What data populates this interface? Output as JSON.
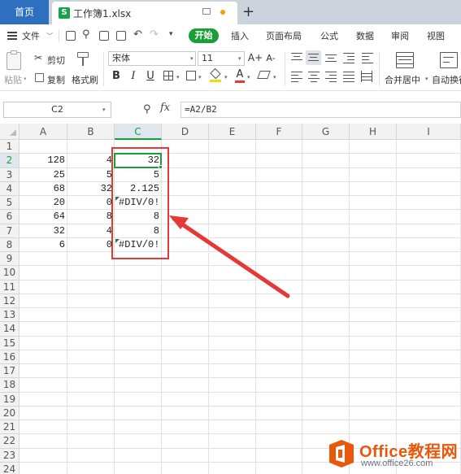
{
  "tabs": {
    "home": "首页",
    "document": "工作簿1.xlsx",
    "doc_icon": "S"
  },
  "menu": {
    "file": "文件",
    "items": [
      "开始",
      "插入",
      "页面布局",
      "公式",
      "数据",
      "审阅",
      "视图"
    ]
  },
  "ribbon": {
    "paste": "粘贴",
    "cut": "剪切",
    "copy": "复制",
    "format_painter": "格式刷",
    "font_name": "宋体",
    "font_size": "11",
    "merge_center": "合并居中",
    "auto_wrap": "自动换行",
    "font_grow": "A+",
    "font_shrink": "A-",
    "bold": "B",
    "italic": "I",
    "underline": "U",
    "font_color_glyph": "A"
  },
  "formula_bar": {
    "cell_ref": "C2",
    "fx": "fx",
    "formula": "=A2/B2"
  },
  "sheet": {
    "columns": [
      "A",
      "B",
      "C",
      "D",
      "E",
      "F",
      "G",
      "H",
      "I"
    ],
    "active_column": "C",
    "active_row": 2,
    "rows": [
      {
        "row": 1,
        "A": "",
        "B": "",
        "C": ""
      },
      {
        "row": 2,
        "A": "128",
        "B": "4",
        "C": "32"
      },
      {
        "row": 3,
        "A": "25",
        "B": "5",
        "C": "5"
      },
      {
        "row": 4,
        "A": "68",
        "B": "32",
        "C": "2.125"
      },
      {
        "row": 5,
        "A": "20",
        "B": "0",
        "C": "#DIV/0!"
      },
      {
        "row": 6,
        "A": "64",
        "B": "8",
        "C": "8"
      },
      {
        "row": 7,
        "A": "32",
        "B": "4",
        "C": "8"
      },
      {
        "row": 8,
        "A": "6",
        "B": "0",
        "C": "#DIV/0!"
      },
      {
        "row": 9
      },
      {
        "row": 10
      },
      {
        "row": 11
      },
      {
        "row": 12
      },
      {
        "row": 13
      },
      {
        "row": 14
      },
      {
        "row": 15
      },
      {
        "row": 16
      },
      {
        "row": 17
      },
      {
        "row": 18
      },
      {
        "row": 19
      },
      {
        "row": 20
      },
      {
        "row": 21
      },
      {
        "row": 22
      },
      {
        "row": 23
      },
      {
        "row": 24
      }
    ]
  },
  "watermark": {
    "title": "Office教程网",
    "url": "www.office26.com"
  },
  "colors": {
    "accent_green": "#1a9e37",
    "tab_blue": "#2e6fc0",
    "annotation_red": "#e53935",
    "watermark_orange": "#e8580c"
  }
}
